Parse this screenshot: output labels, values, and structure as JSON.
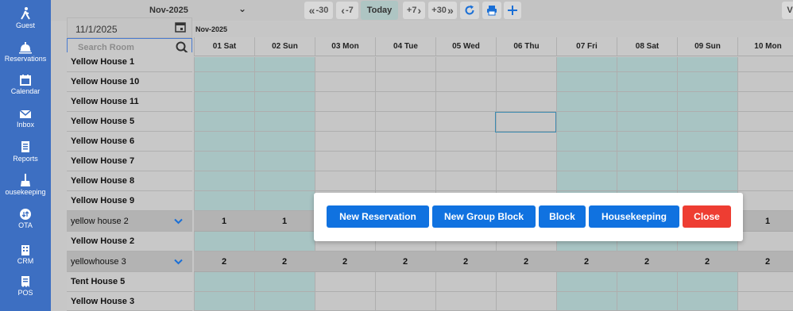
{
  "nav": {
    "items": [
      {
        "label": "Guest",
        "icon": "person-walking-icon"
      },
      {
        "label": "Reservations",
        "icon": "bell-icon"
      },
      {
        "label": "Calendar",
        "icon": "calendar-icon"
      },
      {
        "label": "Inbox",
        "icon": "envelope-icon"
      },
      {
        "label": "Reports",
        "icon": "document-icon"
      },
      {
        "label": "ousekeeping",
        "icon": "broom-icon"
      },
      {
        "label": "OTA",
        "icon": "sync-icon"
      },
      {
        "label": "CRM",
        "icon": "building-icon"
      },
      {
        "label": "POS",
        "icon": "receipt-icon"
      }
    ]
  },
  "toolbar": {
    "month": "Nov-2025",
    "back30": "-30",
    "back7": "-7",
    "today": "Today",
    "fwd7": "+7",
    "fwd30": "+30",
    "cut_label": "V"
  },
  "filters": {
    "date": "11/1/2025",
    "search_placeholder": "Search Room"
  },
  "grid": {
    "month_label": "Nov-2025",
    "days": [
      "01 Sat",
      "02 Sun",
      "03 Mon",
      "04 Tue",
      "05 Wed",
      "06 Thu",
      "07 Fri",
      "08 Sat",
      "09 Sun",
      "10 Mon"
    ],
    "rooms": [
      {
        "name": "Yellow House 1"
      },
      {
        "name": "Yellow House 10"
      },
      {
        "name": "Yellow House 11"
      },
      {
        "name": "Yellow House 5"
      },
      {
        "name": "Yellow House 6"
      },
      {
        "name": "Yellow House 7"
      },
      {
        "name": "Yellow House 8"
      },
      {
        "name": "Yellow House 9"
      },
      {
        "name": "yellow house 2",
        "group": true,
        "values": [
          "1",
          "1",
          "",
          "",
          "",
          "",
          "",
          "",
          "",
          "1"
        ]
      },
      {
        "name": "Yellow House 2"
      },
      {
        "name": "yellowhouse 3",
        "group": true,
        "values": [
          "2",
          "2",
          "2",
          "2",
          "2",
          "2",
          "2",
          "2",
          "2",
          "2"
        ]
      },
      {
        "name": "Tent House 5"
      },
      {
        "name": "Yellow House 3"
      }
    ]
  },
  "dialog": {
    "new_reservation": "New Reservation",
    "new_group_block": "New Group Block",
    "block": "Block",
    "housekeeping": "Housekeeping",
    "close": "Close"
  },
  "colors": {
    "nav_bg": "#3d6fc2",
    "weekend_col": "#a8c4c3",
    "primary_button": "#1072e0",
    "close_button": "#ee3d32"
  }
}
